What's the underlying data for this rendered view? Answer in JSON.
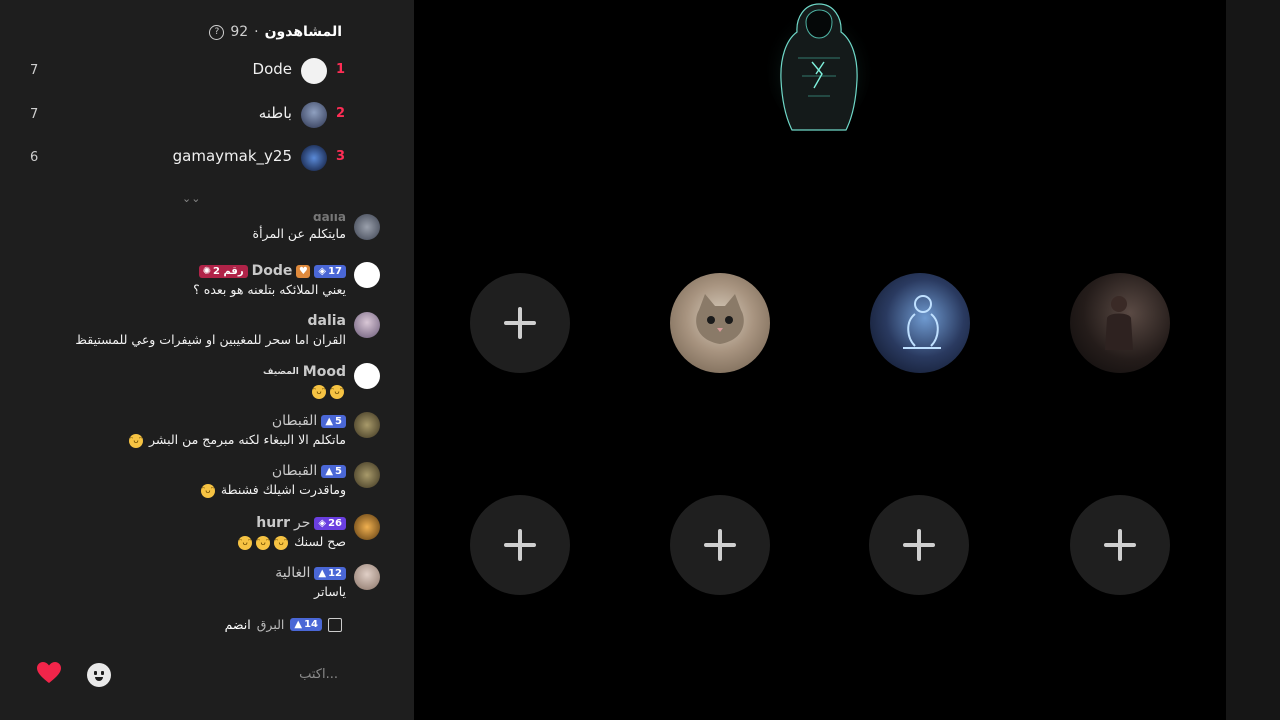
{
  "viewers": {
    "title": "المشاهدون",
    "separator": "·",
    "count": "92",
    "help_icon": "question-circle-icon"
  },
  "top_gifters": [
    {
      "rank": "1",
      "name": "Dode",
      "score": "7",
      "avatar_color": "#f2f2f2"
    },
    {
      "rank": "2",
      "name": "باطنه",
      "score": "7",
      "avatar_color": "#4a5a7a"
    },
    {
      "rank": "3",
      "name": "gamaymak_y25",
      "score": "6",
      "avatar_color": "#1b2a5a"
    }
  ],
  "messages": [
    {
      "user": "dalia",
      "text": "مايتكلم عن المرأة",
      "avatar_color": "#6a6f7a",
      "partial": true
    },
    {
      "user": "Dode",
      "badges": [
        "17",
        "رقم 2"
      ],
      "text": "يعني الملائكه بتلعنه هو بعده ؟",
      "avatar_color": "#ffffff"
    },
    {
      "user": "dalia",
      "text": "القران اما سحر للمغيبين او شيفرات وعي للمستيقظ",
      "avatar_color": "#9a8fa8"
    },
    {
      "user": "Mood",
      "role": "المضيف",
      "emojis": [
        "😂",
        "🤣"
      ],
      "avatar_color": "#ffffff"
    },
    {
      "user": "القبطان",
      "badges": [
        "5"
      ],
      "text": "ماتكلم الا الببغاء لكنه مبرمج من البشر",
      "emojis": [
        "😁"
      ],
      "avatar_color": "#8a7a4a"
    },
    {
      "user": "القبطان",
      "badges": [
        "5"
      ],
      "text": "وماقدرت اشيلك فشنطة",
      "emojis": [
        "😁"
      ],
      "avatar_color": "#8a7a4a"
    },
    {
      "user": "hurr",
      "prefix": "حر",
      "badges": [
        "26"
      ],
      "text": "صح لسنك",
      "emojis": [
        "😭",
        "😭",
        "😭"
      ],
      "avatar_color": "#c88a3a"
    },
    {
      "user": "الغالية",
      "badges": [
        "12"
      ],
      "text": "ياساتر",
      "avatar_color": "#b9a9a0"
    }
  ],
  "join_notice": {
    "user": "البرق",
    "badge": "14",
    "text": "انضم"
  },
  "composer": {
    "placeholder": "اكتب...",
    "heart_icon": "heart-icon",
    "emoji_icon": "emoji-icon"
  },
  "stage": {
    "host_icon": "host-hooded-avatar",
    "seats": [
      {
        "type": "empty"
      },
      {
        "type": "user",
        "label": "kitten"
      },
      {
        "type": "user",
        "label": "blue-figure"
      },
      {
        "type": "user",
        "label": "dark-photo"
      },
      {
        "type": "empty"
      },
      {
        "type": "empty"
      },
      {
        "type": "empty"
      },
      {
        "type": "empty"
      }
    ]
  }
}
